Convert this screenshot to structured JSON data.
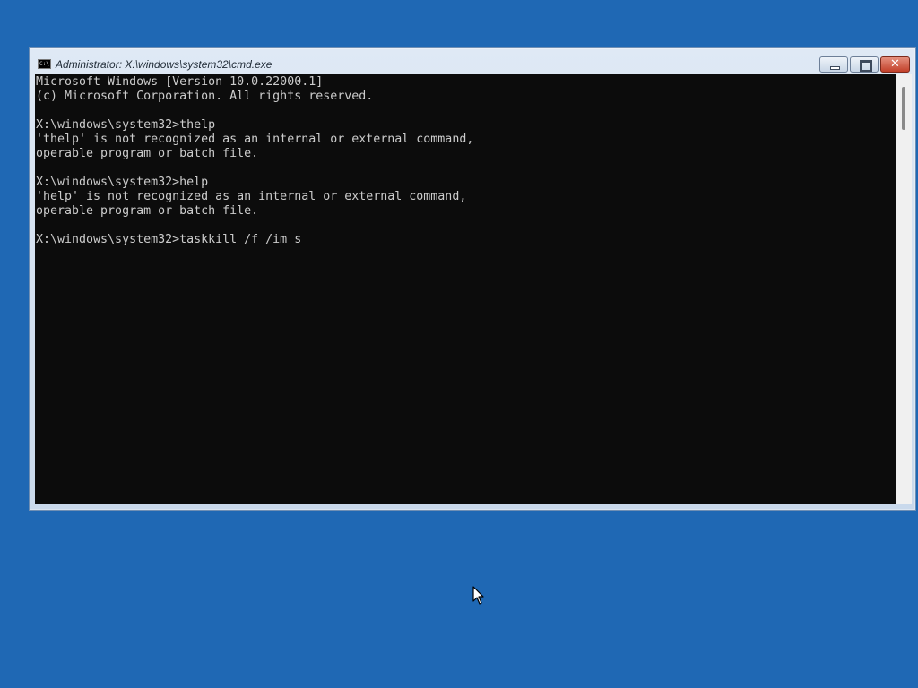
{
  "window": {
    "title": "Administrator: X:\\windows\\system32\\cmd.exe",
    "icon": "console-icon",
    "icon_label": "C:\\."
  },
  "console": {
    "lines": [
      "Microsoft Windows [Version 10.0.22000.1]",
      "(c) Microsoft Corporation. All rights reserved.",
      "",
      "X:\\windows\\system32>thelp",
      "'thelp' is not recognized as an internal or external command,",
      "operable program or batch file.",
      "",
      "X:\\windows\\system32>help",
      "'help' is not recognized as an internal or external command,",
      "operable program or batch file.",
      "",
      "X:\\windows\\system32>taskkill /f /im s"
    ]
  },
  "buttons": {
    "minimize": "minimize-icon",
    "maximize": "maximize-icon",
    "close": "close-icon",
    "close_glyph": "✕"
  },
  "colors": {
    "desktop": "#1f68b4",
    "console_bg": "#0c0c0c",
    "console_text": "#cccccc",
    "close_button": "#c2402a"
  }
}
